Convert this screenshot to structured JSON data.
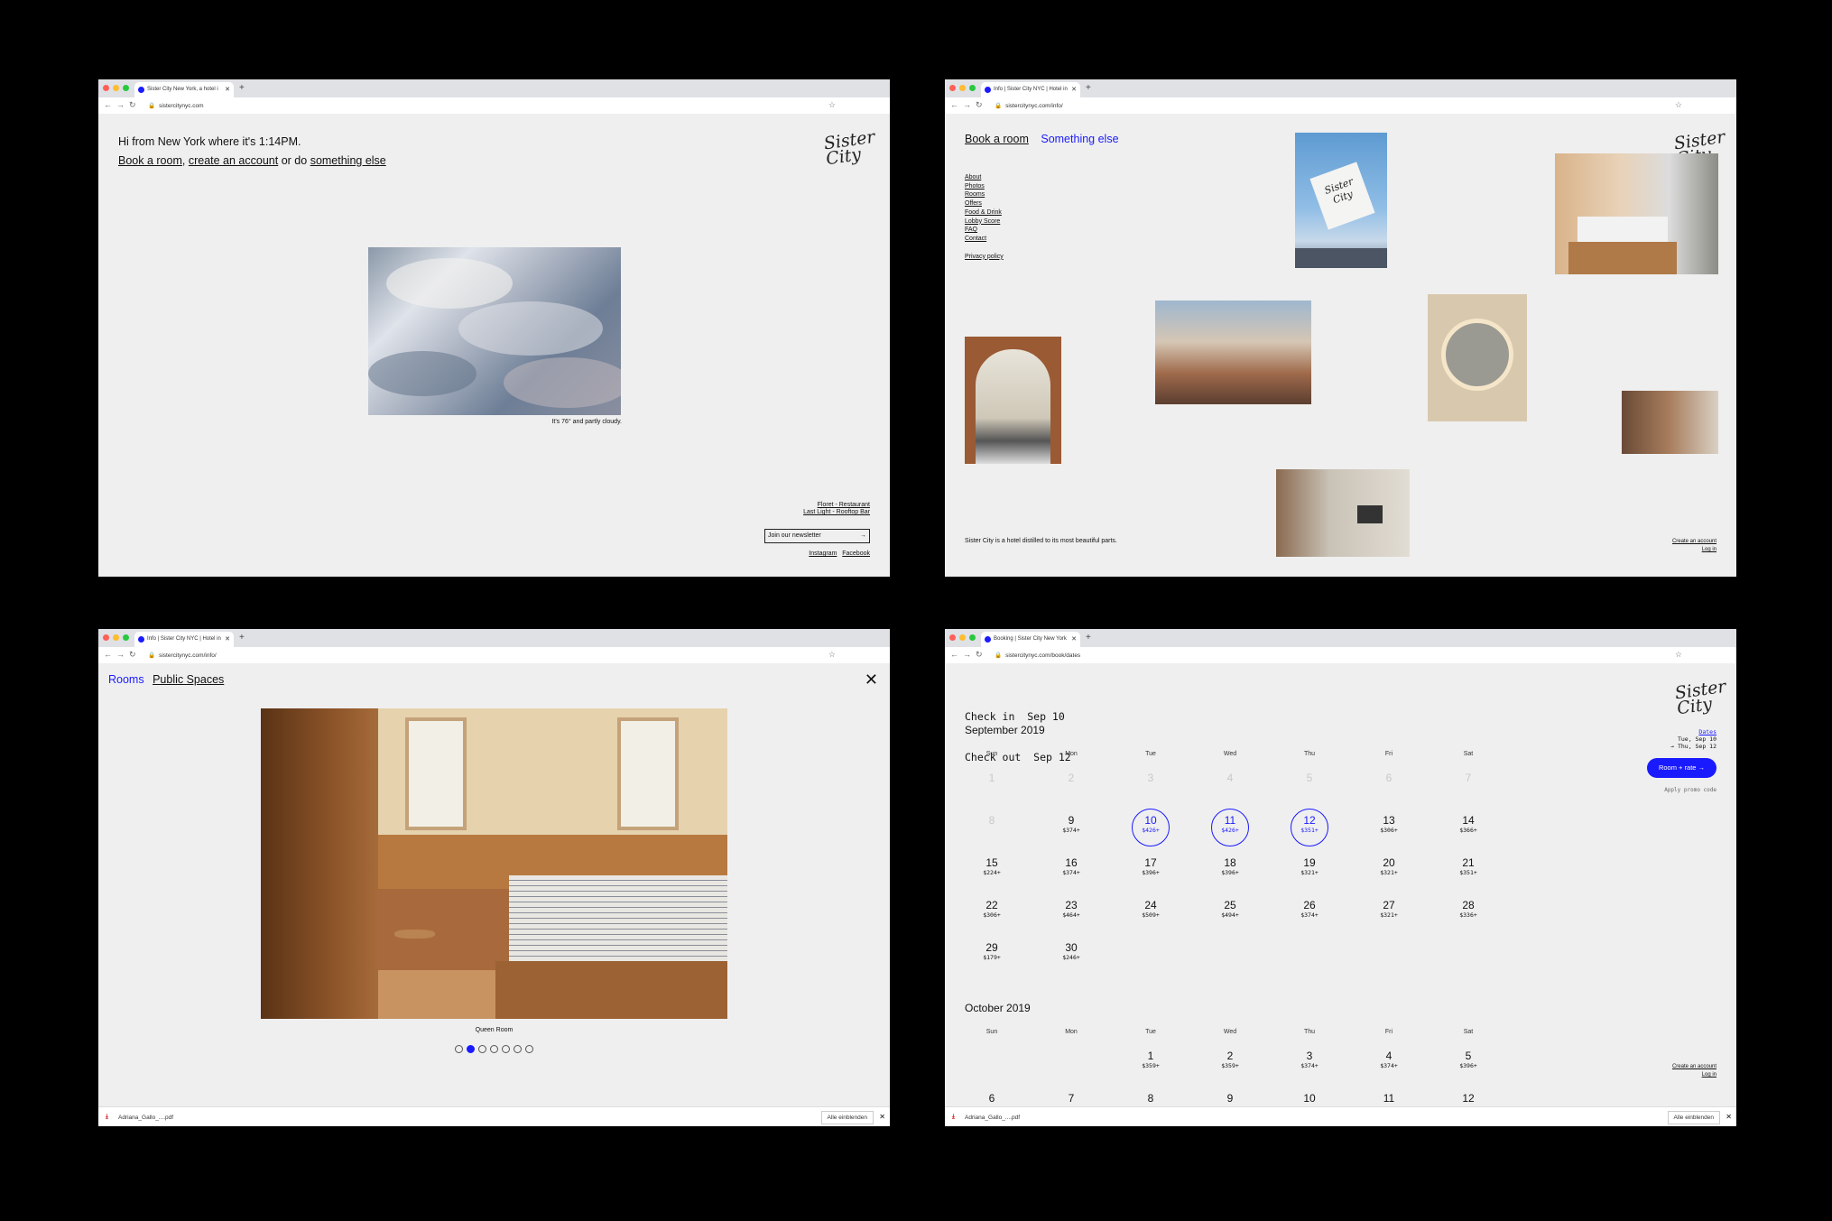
{
  "colors": {
    "accent": "#1a1aff",
    "background": "#000000",
    "page": "#efefef"
  },
  "windows": [
    {
      "tab_title": "Sister City New York, a hotel i",
      "url": "sistercitynyc.com",
      "greeting": "Hi from New York where it's 1:14PM.",
      "links": {
        "book": "Book a room",
        "sep1": ",",
        "account": "create an account",
        "sep2": "or do",
        "else": "something else"
      },
      "logo_text": "Sister City",
      "weather_caption": "It's 76° and partly cloudy.",
      "footer_links": [
        "Floret - Restaurant",
        "Last Light - Rooftop Bar"
      ],
      "newsletter": "Join our newsletter",
      "social": [
        "Instagram",
        "Facebook"
      ]
    },
    {
      "tab_title": "Info | Sister City NYC | Hotel in",
      "url": "sistercitynyc.com/info/",
      "top_links": [
        "Book a room",
        "Something else"
      ],
      "nav": [
        "About",
        "Photos",
        "Rooms",
        "Offers",
        "Food & Drink",
        "Lobby Score",
        "FAQ",
        "Contact"
      ],
      "privacy": "Privacy policy",
      "tagline": "Sister City is a hotel distilled to its most beautiful parts.",
      "account_links": [
        "Create an account",
        "Log in"
      ],
      "flag_text": "Sister City"
    },
    {
      "tab_title": "Info | Sister City NYC | Hotel in",
      "url": "sistercitynyc.com/info/",
      "tabs": [
        "Rooms",
        "Public Spaces"
      ],
      "caption": "Queen Room",
      "dots_total": 7,
      "dots_active": 2,
      "download_file": "Adriana_Gallo_....pdf",
      "show_all": "Alle einblenden"
    },
    {
      "tab_title": "Booking | Sister City New York",
      "url": "sistercitynyc.com/book/dates",
      "checkin": "Check in  Sep 10",
      "checkout": "Check out  Sep 12",
      "sidebar": {
        "dates_link": "Dates",
        "range1": "Tue, Sep 10",
        "range2": "→ Thu, Sep 12",
        "cta": "Room + rate →",
        "promo": "Apply promo code"
      },
      "account_links": [
        "Create an account",
        "Log in"
      ],
      "weekdays": [
        "Sun",
        "Mon",
        "Tue",
        "Wed",
        "Thu",
        "Fri",
        "Sat"
      ],
      "months": [
        {
          "title": "September 2019",
          "rows": [
            [
              {
                "d": "1",
                "p": "",
                "past": true
              },
              {
                "d": "2",
                "p": "",
                "past": true
              },
              {
                "d": "3",
                "p": "",
                "past": true
              },
              {
                "d": "4",
                "p": "",
                "past": true
              },
              {
                "d": "5",
                "p": "",
                "past": true
              },
              {
                "d": "6",
                "p": "",
                "past": true
              },
              {
                "d": "7",
                "p": "",
                "past": true
              }
            ],
            [
              {
                "d": "8",
                "p": "",
                "past": true
              },
              {
                "d": "9",
                "p": "$374+"
              },
              {
                "d": "10",
                "p": "$426+",
                "sel": true
              },
              {
                "d": "11",
                "p": "$426+",
                "sel": true
              },
              {
                "d": "12",
                "p": "$351+",
                "sel": true
              },
              {
                "d": "13",
                "p": "$306+"
              },
              {
                "d": "14",
                "p": "$366+"
              }
            ],
            [
              {
                "d": "15",
                "p": "$224+"
              },
              {
                "d": "16",
                "p": "$374+"
              },
              {
                "d": "17",
                "p": "$396+"
              },
              {
                "d": "18",
                "p": "$396+"
              },
              {
                "d": "19",
                "p": "$321+"
              },
              {
                "d": "20",
                "p": "$321+"
              },
              {
                "d": "21",
                "p": "$351+"
              }
            ],
            [
              {
                "d": "22",
                "p": "$306+"
              },
              {
                "d": "23",
                "p": "$464+"
              },
              {
                "d": "24",
                "p": "$509+"
              },
              {
                "d": "25",
                "p": "$494+"
              },
              {
                "d": "26",
                "p": "$374+"
              },
              {
                "d": "27",
                "p": "$321+"
              },
              {
                "d": "28",
                "p": "$336+"
              }
            ],
            [
              {
                "d": "29",
                "p": "$179+"
              },
              {
                "d": "30",
                "p": "$246+"
              }
            ]
          ]
        },
        {
          "title": "October 2019",
          "rows": [
            [
              null,
              null,
              {
                "d": "1",
                "p": "$359+"
              },
              {
                "d": "2",
                "p": "$359+"
              },
              {
                "d": "3",
                "p": "$374+"
              },
              {
                "d": "4",
                "p": "$374+"
              },
              {
                "d": "5",
                "p": "$396+"
              }
            ],
            [
              {
                "d": "6",
                "p": ""
              },
              {
                "d": "7",
                "p": ""
              },
              {
                "d": "8",
                "p": ""
              },
              {
                "d": "9",
                "p": ""
              },
              {
                "d": "10",
                "p": ""
              },
              {
                "d": "11",
                "p": ""
              },
              {
                "d": "12",
                "p": ""
              }
            ]
          ]
        }
      ],
      "download_file": "Adriana_Gallo_....pdf",
      "show_all": "Alle einblenden"
    }
  ]
}
